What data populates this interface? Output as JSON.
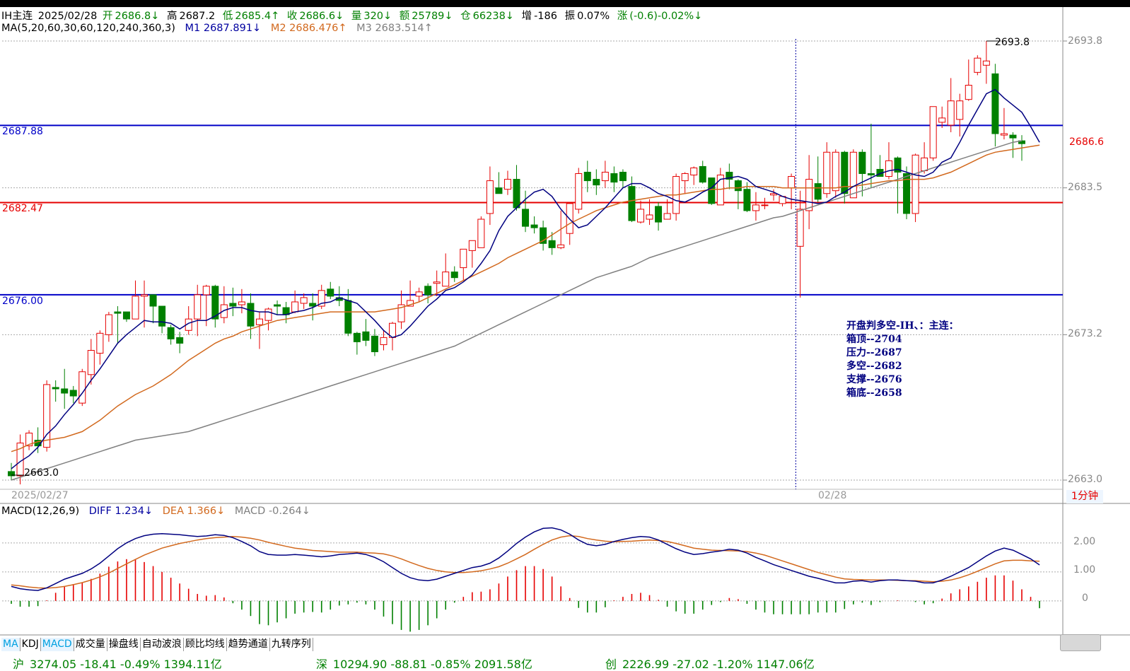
{
  "header": {
    "symbol": "IH主连",
    "date": "2025/02/28",
    "open_label": "开",
    "open": "2686.8↓",
    "high_label": "高",
    "high": "2687.2",
    "low_label": "低",
    "low": "2685.4↑",
    "close_label": "收",
    "close": "2686.6↓",
    "volume_label": "量",
    "volume": "320↓",
    "amount_label": "额",
    "amount": "25789↓",
    "oi_label": "仓",
    "oi": "66238↓",
    "increase_label": "增",
    "increase": "-186",
    "amplitude_label": "振",
    "amplitude": "0.07%",
    "change_label": "涨",
    "change": "(-0.6)-0.02%↓"
  },
  "ma_row": {
    "title": "MA(5,20,60,30,60,120,240,360,3)",
    "m1": "M1 2687.891↓",
    "m2": "M2 2686.476↑",
    "m3": "M3 2683.514↑"
  },
  "macd_row": {
    "title": "MACD(12,26,9)",
    "diff": "DIFF 1.234↓",
    "dea": "DEA 1.366↓",
    "macd": "MACD -0.264↓"
  },
  "price_axis": [
    "2693.8",
    "2683.5",
    "2673.2",
    "2663.0"
  ],
  "current_price": "2686.6",
  "hlines": [
    {
      "label": "2687.88",
      "value": 2687.88,
      "color": "#0000c8"
    },
    {
      "label": "2682.47",
      "value": 2682.47,
      "color": "#e60000"
    },
    {
      "label": "2676.00",
      "value": 2676.0,
      "color": "#0000c8"
    }
  ],
  "high_mark": "2693.8",
  "low_mark": "2663.0",
  "dates": {
    "left": "2025/02/27",
    "mid": "02/28"
  },
  "period": "1分钟",
  "annotation": {
    "title": "开盘判多空-IH、：主连：",
    "lines": [
      "箱顶--2704",
      "压力--2687",
      "多空--2682",
      "支撑--2676",
      "箱底--2658"
    ]
  },
  "macd_axis": [
    "2.00",
    "1.00",
    "0"
  ],
  "tabs": [
    "MA",
    "KDJ",
    "MACD",
    "成交量",
    "操盘线",
    "自动波浪",
    "顾比均线",
    "趋势通道",
    "九转序列"
  ],
  "ticker": [
    {
      "name": "沪",
      "text": "3274.05 -18.41 -0.49% 1394.11亿"
    },
    {
      "name": "深",
      "text": "10294.90 -88.81 -0.85% 2091.58亿"
    },
    {
      "name": "创",
      "text": "2226.99 -27.02 -1.20% 1147.06亿"
    }
  ],
  "colors": {
    "up": "#e60000",
    "down": "#008000",
    "ma1": "#000080",
    "ma2": "#d2691e",
    "ma3": "#808080",
    "diff": "#000080",
    "dea": "#d2691e"
  },
  "chart_data": {
    "type": "candlestick",
    "price_range": [
      2663.0,
      2693.8
    ],
    "candles": [
      [
        2663.6,
        2663.3,
        2664.2,
        2663.0
      ],
      [
        2663.3,
        2665.6,
        2666.2,
        2662.7
      ],
      [
        2665.4,
        2666.3,
        2666.5,
        2665.1
      ],
      [
        2665.8,
        2665.4,
        2666.7,
        2664.9
      ],
      [
        2665.3,
        2669.7,
        2670.0,
        2665.0
      ],
      [
        2669.5,
        2669.4,
        2670.0,
        2668.5
      ],
      [
        2669.4,
        2669.1,
        2670.8,
        2668.0
      ],
      [
        2669.3,
        2668.9,
        2669.6,
        2668.4
      ],
      [
        2668.4,
        2670.6,
        2670.8,
        2668.2
      ],
      [
        2670.4,
        2672.1,
        2672.9,
        2669.7
      ],
      [
        2671.9,
        2673.3,
        2673.5,
        2671.1
      ],
      [
        2673.2,
        2674.6,
        2674.8,
        2672.7
      ],
      [
        2674.8,
        2674.7,
        2675.2,
        2672.6
      ],
      [
        2674.8,
        2674.3,
        2674.8,
        2674.1
      ],
      [
        2674.3,
        2675.9,
        2677.0,
        2674.3
      ],
      [
        2675.9,
        2676.0,
        2677.0,
        2673.7
      ],
      [
        2676.0,
        2675.2,
        2676.0,
        2674.0
      ],
      [
        2675.2,
        2673.8,
        2674.0,
        2673.3
      ],
      [
        2673.7,
        2672.9,
        2673.9,
        2672.5
      ],
      [
        2673.0,
        2672.6,
        2673.4,
        2671.9
      ],
      [
        2673.5,
        2674.3,
        2675.2,
        2673.2
      ],
      [
        2674.3,
        2676.0,
        2676.7,
        2673.1
      ],
      [
        2676.0,
        2676.6,
        2676.7,
        2673.8
      ],
      [
        2676.6,
        2674.3,
        2676.7,
        2673.7
      ],
      [
        2674.4,
        2675.3,
        2676.6,
        2674.0
      ],
      [
        2675.4,
        2675.2,
        2676.5,
        2674.5
      ],
      [
        2675.3,
        2675.5,
        2676.4,
        2674.7
      ],
      [
        2675.4,
        2673.8,
        2676.1,
        2672.9
      ],
      [
        2673.9,
        2674.3,
        2674.8,
        2672.2
      ],
      [
        2674.2,
        2675.0,
        2675.1,
        2673.5
      ],
      [
        2675.3,
        2675.2,
        2675.6,
        2674.6
      ],
      [
        2675.1,
        2674.6,
        2675.5,
        2674.0
      ],
      [
        2674.8,
        2675.5,
        2676.3,
        2674.7
      ],
      [
        2675.4,
        2675.8,
        2676.1,
        2675.0
      ],
      [
        2675.4,
        2675.2,
        2676.1,
        2674.2
      ],
      [
        2675.2,
        2676.3,
        2676.7,
        2675.0
      ],
      [
        2676.4,
        2675.9,
        2676.9,
        2675.7
      ],
      [
        2675.8,
        2675.6,
        2676.6,
        2675.2
      ],
      [
        2675.6,
        2673.3,
        2676.4,
        2673.1
      ],
      [
        2673.3,
        2672.7,
        2673.4,
        2671.8
      ],
      [
        2673.4,
        2672.8,
        2674.3,
        2672.4
      ],
      [
        2673.1,
        2672.0,
        2673.6,
        2671.7
      ],
      [
        2672.5,
        2673.0,
        2673.5,
        2672.1
      ],
      [
        2673.0,
        2674.0,
        2674.1,
        2672.1
      ],
      [
        2674.1,
        2675.3,
        2676.3,
        2673.6
      ],
      [
        2675.2,
        2675.6,
        2677.0,
        2675.2
      ],
      [
        2675.9,
        2676.2,
        2676.5,
        2675.5
      ],
      [
        2676.6,
        2676.0,
        2676.8,
        2675.4
      ],
      [
        2676.8,
        2676.9,
        2677.7,
        2675.9
      ],
      [
        2676.6,
        2677.6,
        2678.9,
        2676.6
      ],
      [
        2677.6,
        2677.2,
        2678.0,
        2676.9
      ],
      [
        2677.9,
        2679.2,
        2679.2,
        2677.0
      ],
      [
        2679.1,
        2679.8,
        2679.8,
        2677.9
      ],
      [
        2679.3,
        2681.3,
        2681.5,
        2679.3
      ],
      [
        2681.7,
        2684.0,
        2685.0,
        2680.9
      ],
      [
        2683.5,
        2683.1,
        2684.6,
        2683.1
      ],
      [
        2683.4,
        2684.1,
        2684.7,
        2683.0
      ],
      [
        2684.1,
        2682.1,
        2685.1,
        2681.9
      ],
      [
        2682.0,
        2680.8,
        2683.3,
        2680.4
      ],
      [
        2680.9,
        2680.7,
        2681.5,
        2680.3
      ],
      [
        2680.7,
        2679.6,
        2681.2,
        2679.1
      ],
      [
        2679.8,
        2679.3,
        2680.4,
        2678.8
      ],
      [
        2679.3,
        2679.5,
        2681.9,
        2679.2
      ],
      [
        2680.3,
        2682.4,
        2682.5,
        2679.5
      ],
      [
        2682.0,
        2684.5,
        2684.9,
        2681.7
      ],
      [
        2684.6,
        2684.0,
        2685.4,
        2683.2
      ],
      [
        2684.1,
        2683.7,
        2684.8,
        2683.0
      ],
      [
        2684.0,
        2684.6,
        2685.4,
        2683.5
      ],
      [
        2684.5,
        2683.9,
        2685.0,
        2683.2
      ],
      [
        2684.6,
        2684.0,
        2684.8,
        2683.5
      ],
      [
        2683.6,
        2681.2,
        2684.3,
        2681.1
      ],
      [
        2681.1,
        2682.0,
        2682.6,
        2681.0
      ],
      [
        2681.3,
        2681.6,
        2682.7,
        2680.9
      ],
      [
        2682.2,
        2681.1,
        2682.5,
        2680.5
      ],
      [
        2681.3,
        2681.7,
        2682.7,
        2681.3
      ],
      [
        2681.7,
        2684.3,
        2684.5,
        2681.2
      ],
      [
        2684.0,
        2684.5,
        2684.6,
        2683.1
      ],
      [
        2684.4,
        2684.9,
        2685.0,
        2683.7
      ],
      [
        2685.0,
        2683.9,
        2685.4,
        2683.8
      ],
      [
        2684.2,
        2682.4,
        2684.2,
        2682.3
      ],
      [
        2682.3,
        2684.4,
        2684.9,
        2682.3
      ],
      [
        2684.6,
        2684.1,
        2685.2,
        2683.4
      ],
      [
        2684.0,
        2683.3,
        2684.1,
        2682.0
      ],
      [
        2683.4,
        2681.9,
        2683.9,
        2681.8
      ],
      [
        2681.9,
        2682.3,
        2683.2,
        2681.2
      ],
      [
        2682.3,
        2682.3,
        2682.8,
        2682.0
      ],
      [
        2683.0,
        2683.1,
        2683.4,
        2682.6
      ],
      [
        2682.4,
        2682.9,
        2682.9,
        2682.2
      ],
      [
        2683.5,
        2684.3,
        2684.5,
        2682.0
      ],
      [
        2679.4,
        2682.0,
        2683.3,
        2675.8
      ],
      [
        2681.9,
        2684.1,
        2685.8,
        2680.6
      ],
      [
        2683.8,
        2682.7,
        2685.7,
        2682.5
      ],
      [
        2683.1,
        2686.0,
        2686.7,
        2682.8
      ],
      [
        2683.3,
        2686.0,
        2686.2,
        2682.8
      ],
      [
        2686.0,
        2683.1,
        2686.1,
        2682.4
      ],
      [
        2682.8,
        2686.0,
        2686.2,
        2682.9
      ],
      [
        2686.0,
        2684.5,
        2686.2,
        2682.9
      ],
      [
        2684.5,
        2684.4,
        2688.0,
        2683.5
      ],
      [
        2684.8,
        2684.3,
        2685.8,
        2684.5
      ],
      [
        2684.3,
        2685.4,
        2686.7,
        2684.1
      ],
      [
        2685.6,
        2684.6,
        2685.7,
        2681.7
      ],
      [
        2684.5,
        2681.7,
        2685.0,
        2681.3
      ],
      [
        2681.7,
        2685.8,
        2685.9,
        2681.1
      ],
      [
        2684.7,
        2685.6,
        2686.7,
        2684.5
      ],
      [
        2685.6,
        2689.2,
        2689.2,
        2685.4
      ],
      [
        2688.1,
        2688.4,
        2689.2,
        2687.7
      ],
      [
        2687.9,
        2689.6,
        2691.2,
        2687.4
      ],
      [
        2688.3,
        2689.6,
        2690.1,
        2687.1
      ],
      [
        2689.7,
        2690.7,
        2692.5,
        2689.6
      ],
      [
        2691.6,
        2692.6,
        2692.8,
        2691.4
      ],
      [
        2692.1,
        2692.4,
        2693.8,
        2690.8
      ],
      [
        2691.5,
        2687.3,
        2692.2,
        2686.4
      ],
      [
        2687.2,
        2687.3,
        2689.1,
        2686.9
      ],
      [
        2687.2,
        2687.0,
        2687.4,
        2685.6
      ],
      [
        2686.8,
        2686.6,
        2687.2,
        2685.4
      ]
    ],
    "ma1_y": [
      2663.8,
      2664.3,
      2664.7,
      2665.3,
      2666.2,
      2666.8,
      2667.6,
      2668.3,
      2669.1,
      2670.0,
      2670.8,
      2671.7,
      2672.6,
      2673.2,
      2673.7,
      2674.2,
      2674.1,
      2674.1,
      2674.0,
      2673.6,
      2674.0,
      2674.2,
      2674.2,
      2674.5,
      2674.9,
      2675.1,
      2675.1,
      2674.9,
      2674.8,
      2674.8,
      2674.6,
      2674.6,
      2674.8,
      2674.9,
      2675.1,
      2675.4,
      2675.5,
      2675.8,
      2675.6,
      2675.4,
      2674.8,
      2674.2,
      2673.5,
      2673.0,
      2673.2,
      2673.8,
      2674.5,
      2675.2,
      2675.7,
      2676.3,
      2676.5,
      2676.9,
      2677.4,
      2678.2,
      2679.1,
      2680.5,
      2681.5,
      2682.1,
      2682.7,
      2683.2,
      2683.4,
      2682.9,
      2682.0,
      2681.3,
      2680.7,
      2680.9,
      2681.5,
      2682.1,
      2682.8,
      2683.5,
      2683.8,
      2683.8,
      2683.5,
      2683.1,
      2682.9,
      2682.6,
      2682.5,
      2682.8,
      2683.2,
      2683.5,
      2684.1,
      2684.2,
      2684.3,
      2684.1,
      2683.6,
      2683.4,
      2683.2,
      2682.9,
      2682.7,
      2682.6,
      2682.5,
      2682.4,
      2682.5,
      2682.9,
      2683.2,
      2683.6,
      2683.9,
      2684.2,
      2684.5,
      2684.7,
      2684.8,
      2684.6,
      2684.4,
      2684.3,
      2684.6,
      2685.3,
      2685.6,
      2686.7,
      2687.9,
      2689.0,
      2690.1,
      2690.4,
      2689.8,
      2689.3,
      2688.8,
      2687.8,
      2686.7
    ],
    "ma2_y": [
      2665.0,
      2665.2,
      2665.5,
      2665.7,
      2665.8,
      2665.9,
      2666.0,
      2666.2,
      2666.4,
      2666.8,
      2667.2,
      2667.7,
      2668.2,
      2668.6,
      2669.0,
      2669.3,
      2669.6,
      2670.0,
      2670.4,
      2670.9,
      2671.4,
      2671.8,
      2672.2,
      2672.6,
      2672.9,
      2673.1,
      2673.4,
      2673.6,
      2673.8,
      2674.0,
      2674.2,
      2674.3,
      2674.4,
      2674.5,
      2674.6,
      2674.7,
      2674.8,
      2674.8,
      2674.8,
      2674.8,
      2674.8,
      2674.8,
      2674.9,
      2675.0,
      2675.1,
      2675.3,
      2675.5,
      2675.8,
      2676.1,
      2676.4,
      2676.7,
      2677.0,
      2677.3,
      2677.6,
      2677.9,
      2678.2,
      2678.6,
      2678.9,
      2679.2,
      2679.5,
      2679.8,
      2680.2,
      2680.6,
      2681.0,
      2681.3,
      2681.6,
      2681.9,
      2682.1,
      2682.3,
      2682.5,
      2682.6,
      2682.7,
      2682.8,
      2682.9,
      2683.0,
      2683.0,
      2683.1,
      2683.2,
      2683.3,
      2683.4,
      2683.4,
      2683.5,
      2683.5,
      2683.6,
      2683.6,
      2683.6,
      2683.6,
      2683.5,
      2683.5,
      2683.5,
      2683.5,
      2683.5,
      2683.5,
      2683.5,
      2683.6,
      2683.6,
      2683.7,
      2683.8,
      2683.9,
      2684.0,
      2684.0,
      2684.1,
      2684.1,
      2684.1,
      2684.2,
      2684.4,
      2684.6,
      2684.9,
      2685.2,
      2685.5,
      2685.8,
      2686.0,
      2686.1,
      2686.2,
      2686.3,
      2686.4,
      2686.5
    ],
    "ma3_y": [
      2663.0,
      2663.2,
      2663.4,
      2663.6,
      2663.8,
      2664.0,
      2664.2,
      2664.4,
      2664.6,
      2664.8,
      2665.0,
      2665.2,
      2665.4,
      2665.6,
      2665.8,
      2665.9,
      2666.0,
      2666.1,
      2666.2,
      2666.3,
      2666.4,
      2666.6,
      2666.8,
      2667.0,
      2667.2,
      2667.4,
      2667.6,
      2667.8,
      2668.0,
      2668.2,
      2668.4,
      2668.6,
      2668.8,
      2669.0,
      2669.2,
      2669.4,
      2669.6,
      2669.8,
      2670.0,
      2670.2,
      2670.4,
      2670.6,
      2670.8,
      2671.0,
      2671.2,
      2671.4,
      2671.6,
      2671.8,
      2672.0,
      2672.2,
      2672.4,
      2672.7,
      2673.0,
      2673.3,
      2673.6,
      2673.9,
      2674.2,
      2674.5,
      2674.8,
      2675.1,
      2675.4,
      2675.7,
      2676.0,
      2676.3,
      2676.6,
      2676.9,
      2677.2,
      2677.4,
      2677.6,
      2677.8,
      2678.0,
      2678.3,
      2678.6,
      2678.8,
      2679.0,
      2679.2,
      2679.4,
      2679.6,
      2679.8,
      2680.0,
      2680.2,
      2680.4,
      2680.6,
      2680.8,
      2681.0,
      2681.2,
      2681.4,
      2681.5,
      2681.7,
      2681.9,
      2682.1,
      2682.3,
      2682.5,
      2682.7,
      2682.9,
      2683.1,
      2683.3,
      2683.5,
      2683.7,
      2683.9,
      2684.1,
      2684.3,
      2684.5,
      2684.7,
      2684.9,
      2685.1,
      2685.3,
      2685.5,
      2685.7,
      2685.9,
      2686.1,
      2686.3,
      2686.5,
      2686.7,
      2686.8,
      2686.9,
      2683.5
    ],
    "macd_range": [
      -1.1,
      2.8
    ],
    "diff": [
      0.5,
      0.42,
      0.38,
      0.36,
      0.45,
      0.6,
      0.75,
      0.85,
      0.95,
      1.1,
      1.3,
      1.55,
      1.8,
      2.0,
      2.15,
      2.25,
      2.3,
      2.32,
      2.3,
      2.28,
      2.25,
      2.22,
      2.24,
      2.28,
      2.26,
      2.18,
      2.05,
      1.9,
      1.7,
      1.6,
      1.58,
      1.58,
      1.6,
      1.58,
      1.55,
      1.52,
      1.55,
      1.6,
      1.62,
      1.65,
      1.6,
      1.5,
      1.35,
      1.15,
      0.95,
      0.8,
      0.72,
      0.7,
      0.75,
      0.85,
      0.95,
      1.05,
      1.15,
      1.2,
      1.3,
      1.48,
      1.72,
      1.98,
      2.2,
      2.38,
      2.5,
      2.52,
      2.45,
      2.3,
      2.1,
      1.95,
      1.9,
      1.95,
      2.05,
      2.12,
      2.18,
      2.22,
      2.2,
      2.1,
      1.95,
      1.8,
      1.68,
      1.6,
      1.63,
      1.68,
      1.72,
      1.78,
      1.75,
      1.65,
      1.5,
      1.38,
      1.25,
      1.15,
      1.05,
      0.95,
      0.85,
      0.78,
      0.7,
      0.62,
      0.62,
      0.68,
      0.7,
      0.65,
      0.7,
      0.72,
      0.72,
      0.7,
      0.68,
      0.62,
      0.62,
      0.72,
      0.85,
      1.0,
      1.15,
      1.35,
      1.55,
      1.72,
      1.82,
      1.75,
      1.6,
      1.45,
      1.24
    ],
    "dea": [
      0.55,
      0.52,
      0.48,
      0.45,
      0.44,
      0.46,
      0.5,
      0.56,
      0.63,
      0.72,
      0.83,
      0.96,
      1.12,
      1.28,
      1.43,
      1.58,
      1.7,
      1.82,
      1.9,
      1.98,
      2.04,
      2.1,
      2.15,
      2.18,
      2.2,
      2.22,
      2.2,
      2.16,
      2.1,
      2.02,
      1.95,
      1.88,
      1.82,
      1.78,
      1.74,
      1.72,
      1.7,
      1.68,
      1.68,
      1.68,
      1.66,
      1.65,
      1.62,
      1.55,
      1.45,
      1.33,
      1.22,
      1.12,
      1.05,
      1.0,
      0.98,
      0.98,
      1.0,
      1.04,
      1.1,
      1.18,
      1.3,
      1.45,
      1.6,
      1.78,
      1.95,
      2.1,
      2.2,
      2.25,
      2.22,
      2.15,
      2.1,
      2.06,
      2.04,
      2.05,
      2.06,
      2.08,
      2.1,
      2.08,
      2.05,
      1.98,
      1.9,
      1.82,
      1.78,
      1.75,
      1.74,
      1.73,
      1.72,
      1.7,
      1.65,
      1.58,
      1.48,
      1.38,
      1.28,
      1.18,
      1.08,
      0.98,
      0.9,
      0.82,
      0.76,
      0.74,
      0.73,
      0.72,
      0.72,
      0.72,
      0.71,
      0.7,
      0.7,
      0.68,
      0.66,
      0.68,
      0.72,
      0.8,
      0.9,
      1.02,
      1.15,
      1.28,
      1.38,
      1.4,
      1.4,
      1.38,
      1.366
    ]
  }
}
